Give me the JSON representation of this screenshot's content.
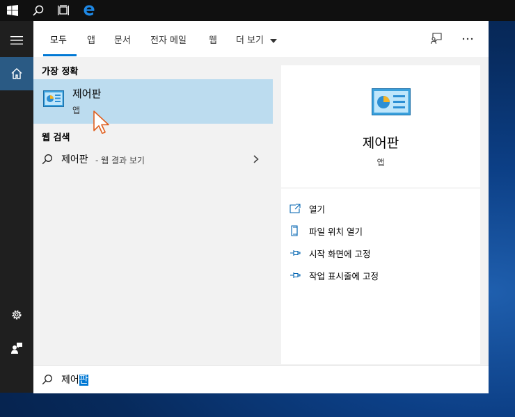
{
  "tabs": [
    {
      "label": "모두"
    },
    {
      "label": "앱"
    },
    {
      "label": "문서"
    },
    {
      "label": "전자 메일"
    },
    {
      "label": "웹"
    },
    {
      "label": "더 보기"
    }
  ],
  "sections": {
    "best_match": "가장 정확",
    "web_search": "웹 검색"
  },
  "best_result": {
    "title": "제어판",
    "subtitle": "앱"
  },
  "web_result": {
    "query": "제어판",
    "suffix": "- 웹 결과 보기"
  },
  "preview": {
    "title": "제어판",
    "subtitle": "앱",
    "actions": [
      {
        "label": "열기"
      },
      {
        "label": "파일 위치 열기"
      },
      {
        "label": "시작 화면에 고정"
      },
      {
        "label": "작업 표시줄에 고정"
      }
    ]
  },
  "search": {
    "typed": "제어",
    "selected": "판"
  },
  "icons": {
    "start": "windows-logo-icon",
    "search": "search-icon",
    "task_view": "task-view-icon",
    "edge": "edge-icon",
    "menu": "hamburger-icon",
    "home": "home-icon",
    "settings": "gear-icon",
    "user": "user-feedback-icon",
    "feedback": "feedback-icon",
    "more": "more-icon"
  },
  "colors": {
    "accent": "#0078d4",
    "selected_row": "#bcdcef",
    "rail": "#1f1f1f",
    "rail_active": "#2a5a84"
  }
}
